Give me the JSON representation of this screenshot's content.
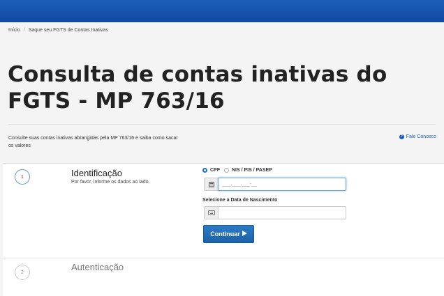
{
  "breadcrumb": {
    "home": "Início",
    "separator": "/",
    "current": "Saque seu FGTS de Contas Inativas"
  },
  "page": {
    "title": "Consulta de contas inativas do FGTS - MP 763/16",
    "intro": "Consulte suas contas inativas abrangidas pela MP 763/16 e saiba como sacar os valores",
    "contact_label": "Fale Conosco",
    "contact_icon": "question-circle-icon"
  },
  "steps": [
    {
      "number": "1",
      "title": "Identificação",
      "description": "Por favor, informe os dados ao lado."
    },
    {
      "number": "2",
      "title": "Autenticação"
    }
  ],
  "form": {
    "radio_options": [
      "CPF",
      "NIS / PIS / PASEP"
    ],
    "radio_selected": "CPF",
    "doc_placeholder": "___.___.___-__",
    "doc_icon": "calculator-icon",
    "birthdate_label": "Selecione a Data de Nascimento",
    "birthdate_icon": "keyboard-icon",
    "birthdate_value": "",
    "continue_label": "Continuar",
    "continue_icon": "play-arrow-icon"
  },
  "colors": {
    "header": "#1650ab",
    "primary": "#1f68ae",
    "link": "#1a5fb4"
  }
}
